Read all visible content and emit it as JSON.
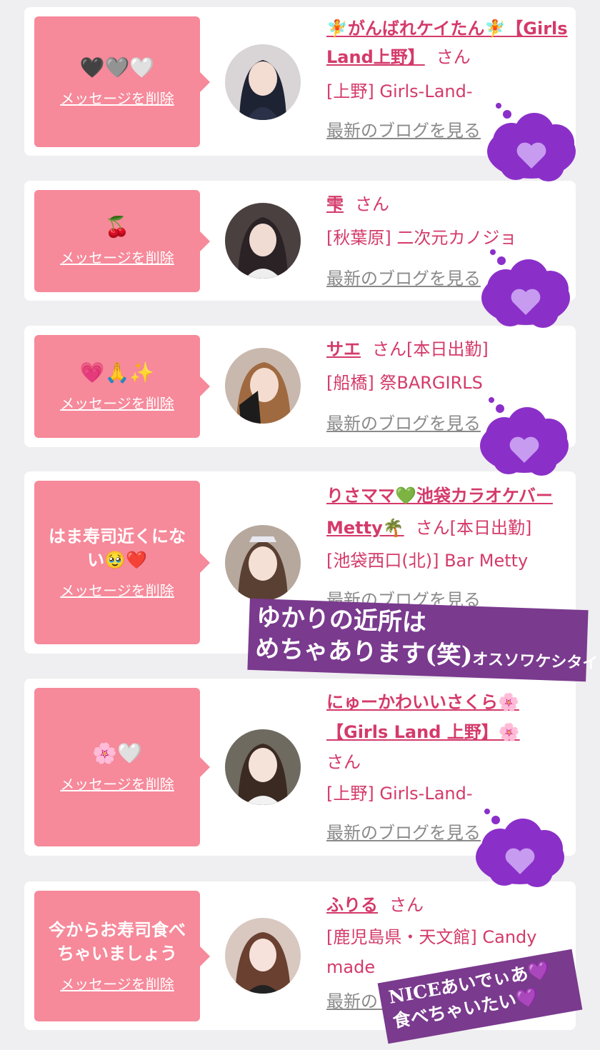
{
  "delete_label": "メッセージを削除",
  "san": "さん",
  "blog_label": "最新のブログを見る",
  "cloud_icon": "purple-heart-cloud",
  "items": [
    {
      "message": "🖤🩶🤍",
      "name": "🧚がんばれケイたん🧚【Girls Land上野】",
      "status": "",
      "shop": "[上野] Girls-Land-"
    },
    {
      "message": "🍒",
      "name": "雫",
      "status": "",
      "shop": "[秋葉原] 二次元カノジョ"
    },
    {
      "message": "💗🙏✨",
      "name": "サエ",
      "status": "[本日出勤]",
      "shop": "[船橋] 祭BARGIRLS"
    },
    {
      "message": "はま寿司近くにない🥹❤️",
      "name": "りさママ💚池袋カラオケバーMetty🌴",
      "status": "[本日出勤]",
      "shop": "[池袋西口(北)] Bar Metty"
    },
    {
      "message": "🌸🤍",
      "name": "にゅーかわいいさくら🌸【Girls Land 上野】🌸",
      "status": "",
      "shop": "[上野] Girls-Land-"
    },
    {
      "message": "今からお寿司食べちゃいましょう",
      "name": "ふりる",
      "status": "",
      "shop": "[鹿児島県・天文館] Candy made"
    }
  ],
  "overlays": {
    "caption1_line1": "ゆかりの近所は",
    "caption1_line2": "めちゃあります(笑)",
    "caption1_small": "オスソワケシタイ",
    "caption2_line1": "NICEあいでぃあ💜",
    "caption2_line2": "食べちゃいたい💜"
  }
}
